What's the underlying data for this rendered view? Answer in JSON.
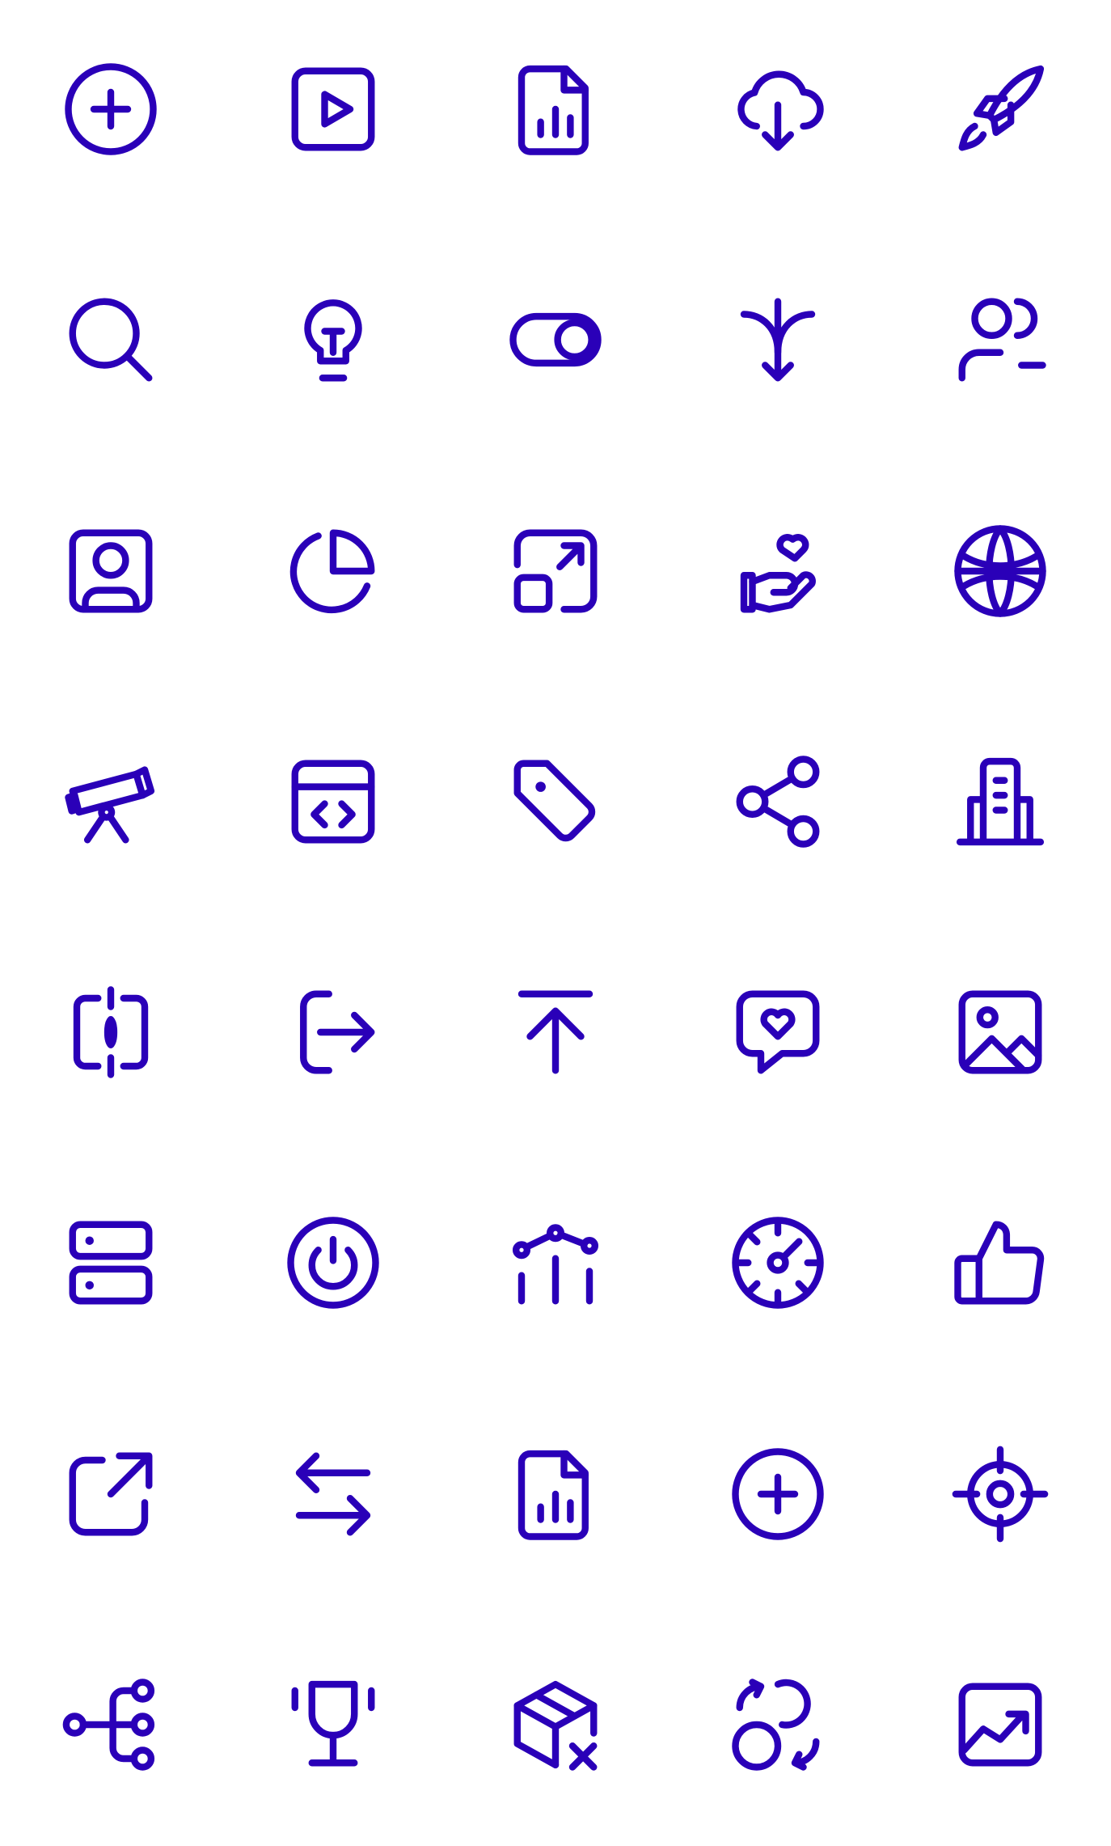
{
  "theme": {
    "icon_color": "#2a00b8",
    "background": "#ffffff"
  },
  "icons": [
    {
      "name": "add-circle-icon"
    },
    {
      "name": "play-square-icon"
    },
    {
      "name": "file-chart-icon"
    },
    {
      "name": "cloud-download-icon"
    },
    {
      "name": "rocket-icon"
    },
    {
      "name": "search-icon"
    },
    {
      "name": "lightbulb-icon"
    },
    {
      "name": "toggle-icon"
    },
    {
      "name": "merge-arrow-icon"
    },
    {
      "name": "user-remove-icon"
    },
    {
      "name": "contact-card-icon"
    },
    {
      "name": "pie-chart-icon"
    },
    {
      "name": "resize-icon"
    },
    {
      "name": "hand-heart-icon"
    },
    {
      "name": "globe-icon"
    },
    {
      "name": "telescope-icon"
    },
    {
      "name": "code-window-icon"
    },
    {
      "name": "tag-icon"
    },
    {
      "name": "share-icon"
    },
    {
      "name": "building-icon"
    },
    {
      "name": "split-frame-icon"
    },
    {
      "name": "logout-icon"
    },
    {
      "name": "upload-top-icon"
    },
    {
      "name": "message-heart-icon"
    },
    {
      "name": "image-icon"
    },
    {
      "name": "server-icon"
    },
    {
      "name": "power-icon"
    },
    {
      "name": "line-bar-chart-icon"
    },
    {
      "name": "speedometer-icon"
    },
    {
      "name": "thumbs-up-icon"
    },
    {
      "name": "external-link-icon"
    },
    {
      "name": "swap-arrows-icon"
    },
    {
      "name": "file-chart-icon"
    },
    {
      "name": "add-circle-icon"
    },
    {
      "name": "target-icon"
    },
    {
      "name": "branch-icon"
    },
    {
      "name": "trophy-icon"
    },
    {
      "name": "box-remove-icon"
    },
    {
      "name": "switch-circles-icon"
    },
    {
      "name": "trend-square-icon"
    }
  ]
}
